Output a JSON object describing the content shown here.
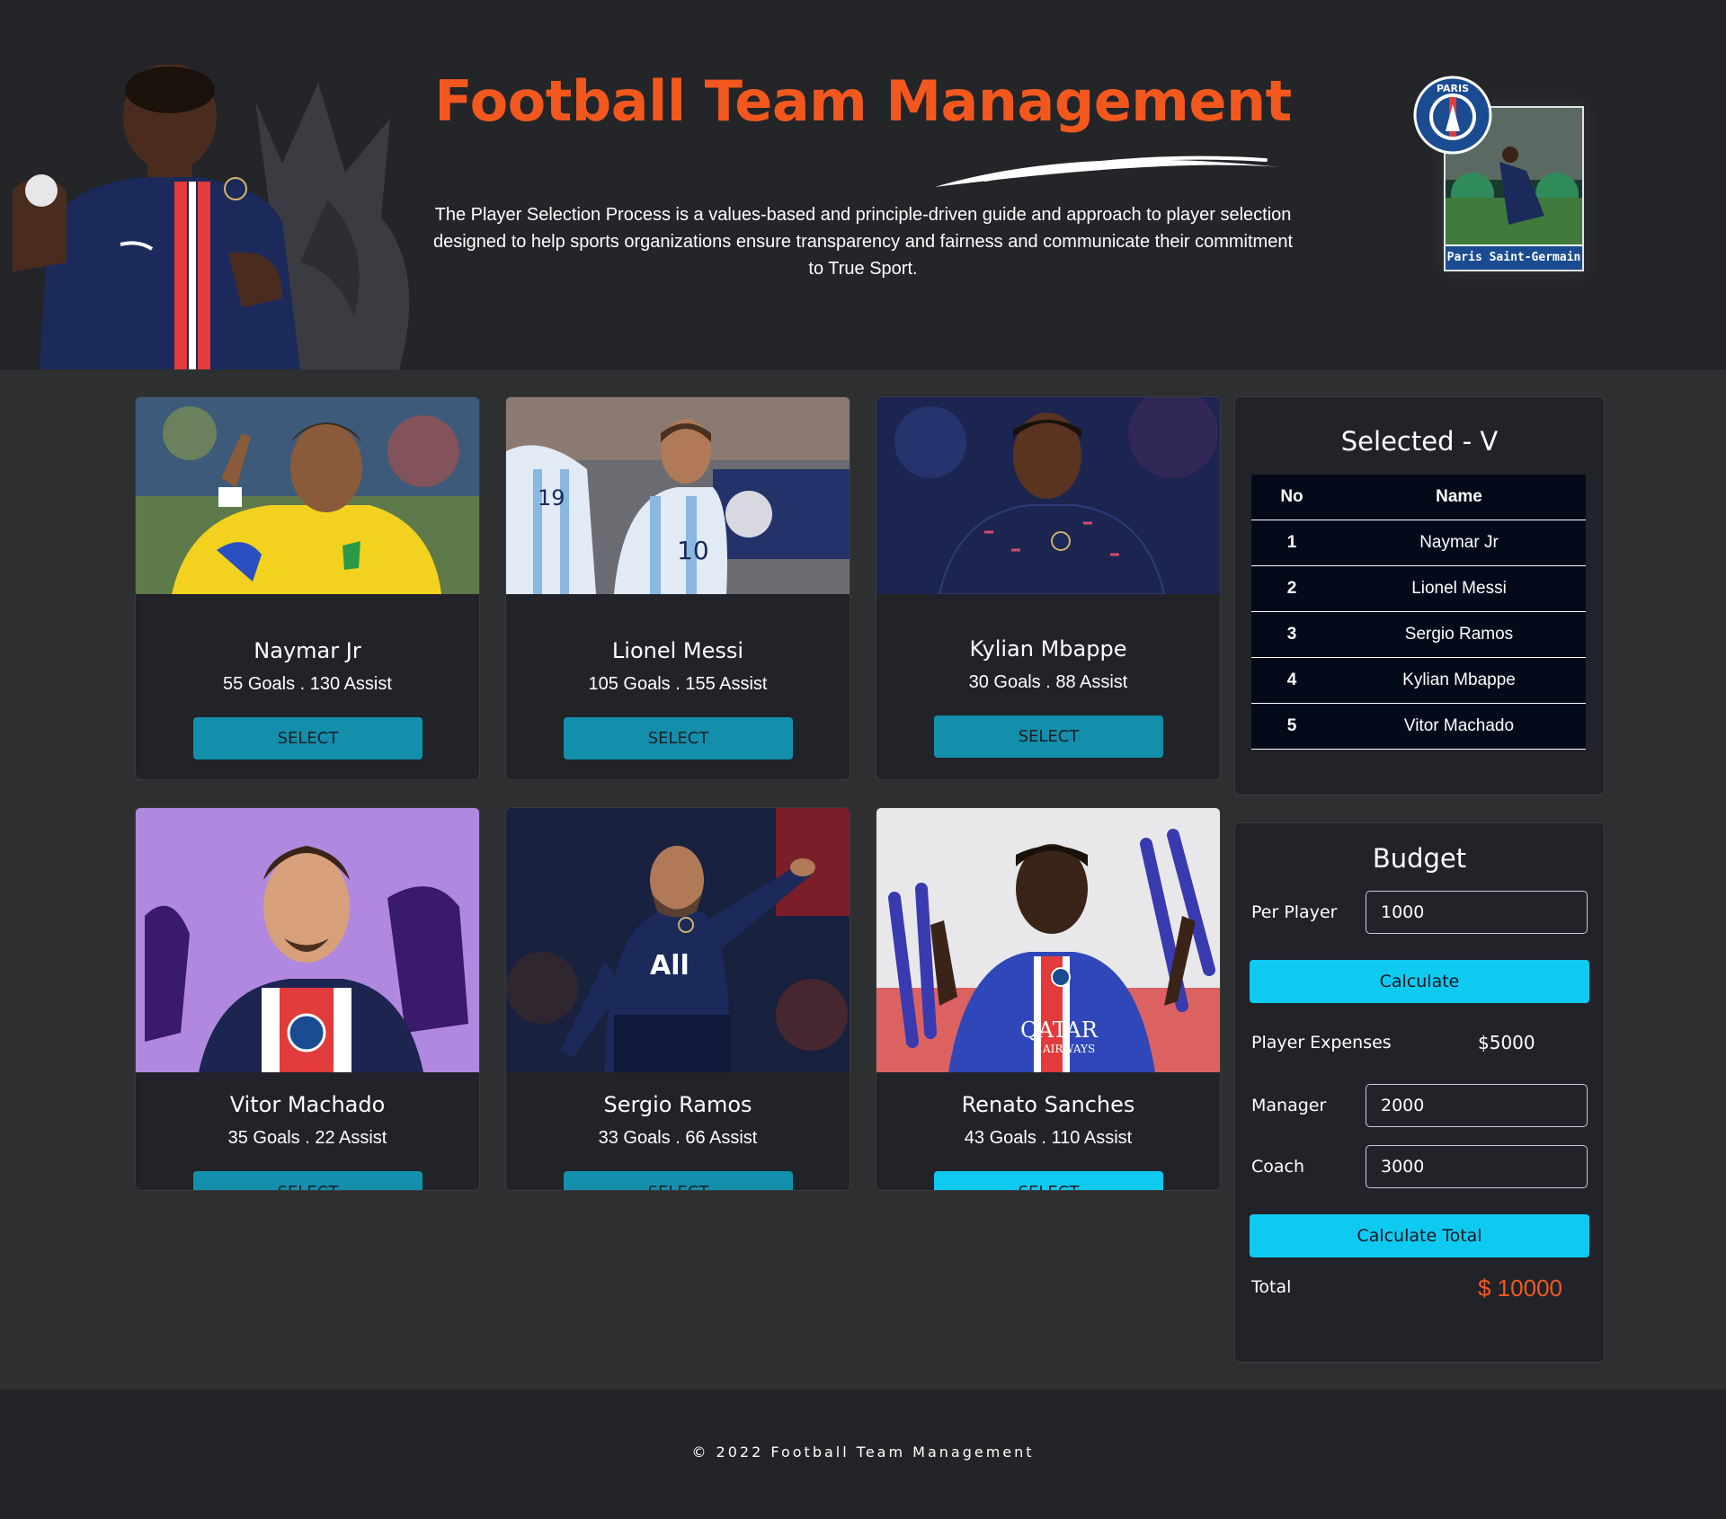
{
  "header": {
    "title": "Football Team Management",
    "intro": "The Player Selection Process is a values-based and principle-driven guide and approach to player selection designed to help sports organizations ensure transparency and fairness and communicate their commitment to True Sport.",
    "badge_label": "Paris Saint-Germain",
    "badge_logo_text": "PARIS"
  },
  "players": [
    {
      "name": "Naymar Jr",
      "stats": "55 Goals . 130 Assist",
      "select_label": "SELECT"
    },
    {
      "name": "Lionel Messi",
      "stats": "105 Goals . 155 Assist",
      "select_label": "SELECT"
    },
    {
      "name": "Kylian Mbappe",
      "stats": "30 Goals . 88 Assist",
      "select_label": "SELECT"
    },
    {
      "name": "Vitor Machado",
      "stats": "35 Goals . 22 Assist",
      "select_label": "SELECT"
    },
    {
      "name": "Sergio Ramos",
      "stats": "33 Goals . 66 Assist",
      "select_label": "SELECT"
    },
    {
      "name": "Renato Sanches",
      "stats": "43 Goals . 110 Assist",
      "select_label": "SELECT"
    }
  ],
  "photo_text": {
    "messi_number": "10",
    "messi_back_number": "19",
    "ramos_sponsor": "All",
    "sanches_sponsor": "QATAR",
    "sanches_sponsor_sub": "AIRWAYS"
  },
  "selected": {
    "title": "Selected - V",
    "columns": [
      "No",
      "Name"
    ],
    "rows": [
      {
        "no": "1",
        "name": "Naymar Jr"
      },
      {
        "no": "2",
        "name": "Lionel Messi"
      },
      {
        "no": "3",
        "name": "Sergio Ramos"
      },
      {
        "no": "4",
        "name": "Kylian Mbappe"
      },
      {
        "no": "5",
        "name": "Vitor Machado"
      }
    ]
  },
  "budget": {
    "title": "Budget",
    "per_player_label": "Per Player",
    "per_player_value": "1000",
    "calculate_label": "Calculate",
    "player_expenses_label": "Player Expenses",
    "player_expenses_value": "$5000",
    "manager_label": "Manager",
    "manager_value": "2000",
    "coach_label": "Coach",
    "coach_value": "3000",
    "calculate_total_label": "Calculate Total",
    "total_label": "Total",
    "total_value": "$ 10000"
  },
  "footer": {
    "text": "© 2022 Football Team Management"
  },
  "colors": {
    "accent_orange": "#f2581e",
    "button_teal": "#138fab",
    "button_cyan": "#0fcaf0",
    "header_bg": "#232529",
    "page_bg": "#2e2f31"
  }
}
